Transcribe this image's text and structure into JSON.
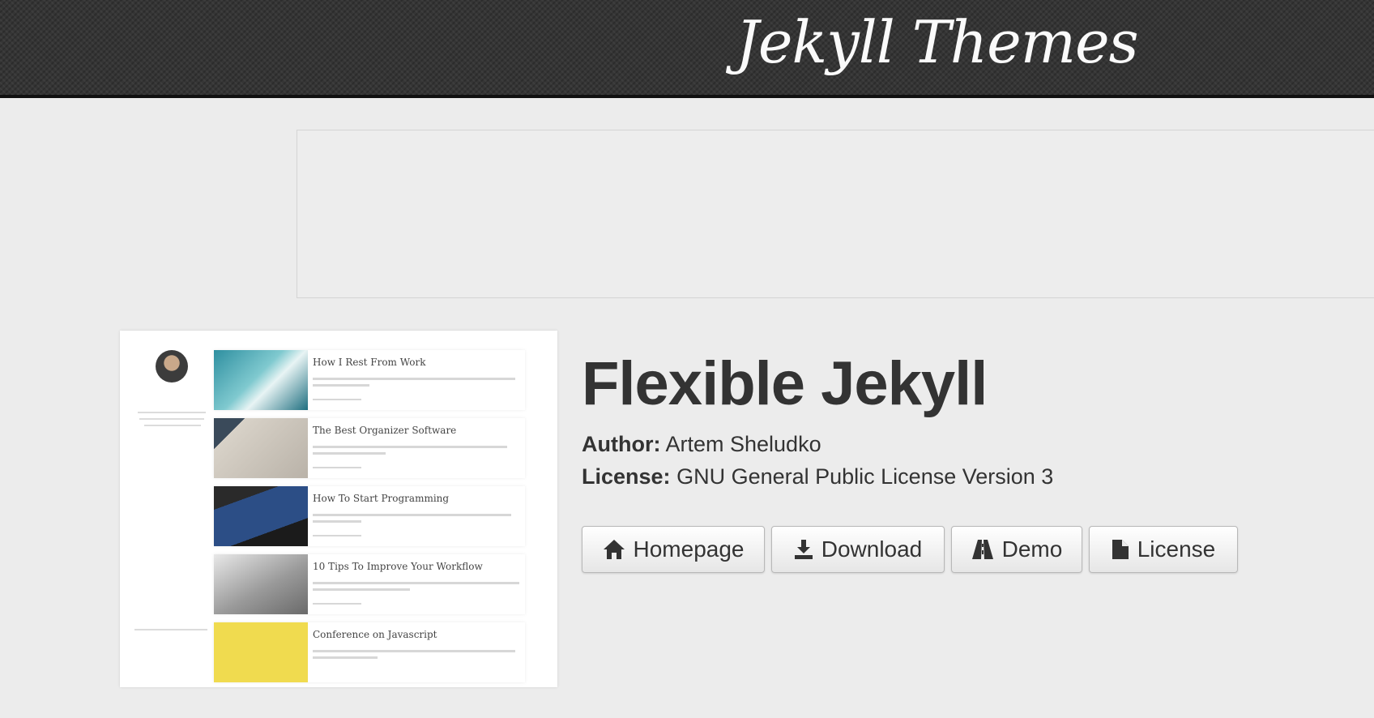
{
  "header": {
    "site_title": "Jekyll Themes"
  },
  "theme": {
    "title": "Flexible Jekyll",
    "author_label": "Author:",
    "author": "Artem Sheludko",
    "license_label": "License:",
    "license": "GNU General Public License Version 3"
  },
  "buttons": {
    "homepage": "Homepage",
    "download": "Download",
    "demo": "Demo",
    "license": "License"
  },
  "preview": {
    "posts": [
      "How I Rest From Work",
      "The Best Organizer Software",
      "How To Start Programming",
      "10 Tips To Improve Your Workflow",
      "Conference on Javascript"
    ]
  },
  "colors": {
    "topbar": "#353535",
    "background": "#ececec",
    "text": "#333333"
  }
}
